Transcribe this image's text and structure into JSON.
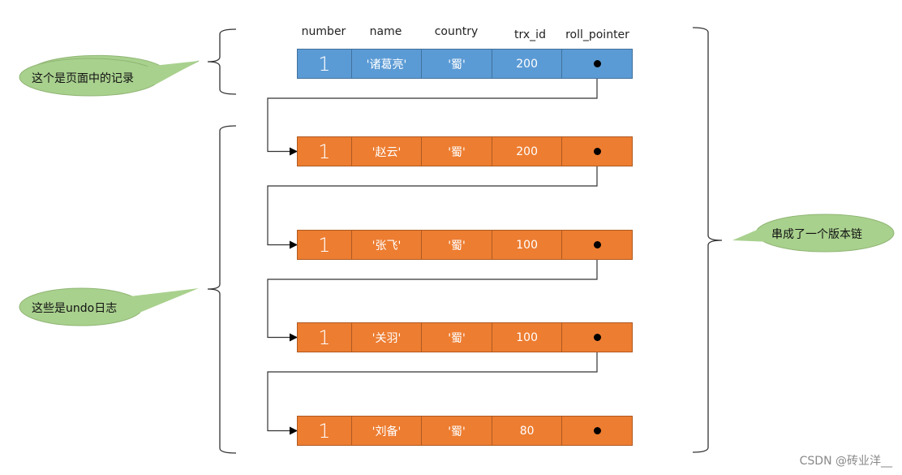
{
  "diagram": {
    "columns": [
      "number",
      "name",
      "country",
      "trx_id",
      "roll_pointer"
    ],
    "current_record": {
      "number": "1",
      "name": "'诸葛亮'",
      "country": "'蜀'",
      "trx_id": "200"
    },
    "undo_records": [
      {
        "number": "1",
        "name": "'赵云'",
        "country": "'蜀'",
        "trx_id": "200"
      },
      {
        "number": "1",
        "name": "'张飞'",
        "country": "'蜀'",
        "trx_id": "100"
      },
      {
        "number": "1",
        "name": "'关羽'",
        "country": "'蜀'",
        "trx_id": "100"
      },
      {
        "number": "1",
        "name": "'刘备'",
        "country": "'蜀'",
        "trx_id": "80"
      }
    ],
    "callouts": {
      "page_record": "这个是页面中的记录",
      "undo_log": "这些是undo日志",
      "version_chain": "串成了一个版本链"
    },
    "colors": {
      "current_fill": "#5b9bd5",
      "undo_fill": "#ed7d31",
      "callout_fill": "#a9d18e"
    }
  },
  "watermark": "CSDN @砖业洋__"
}
